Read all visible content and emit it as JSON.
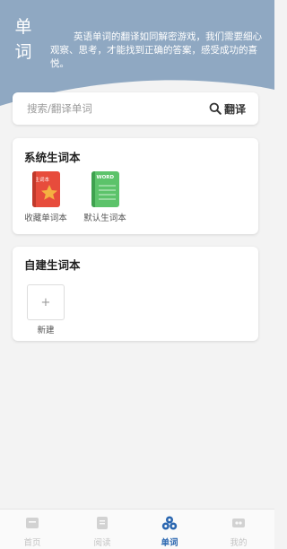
{
  "header": {
    "title": "单词",
    "quote": "英语单词的翻译如同解密游戏，我们需要细心观察、思考，才能找到正确的答案，感受成功的喜悦。"
  },
  "search": {
    "placeholder": "搜索/翻译单词",
    "button_label": "翻译"
  },
  "system_books": {
    "title": "系统生词本",
    "items": [
      {
        "label": "收藏单词本",
        "cover_text": "生词本",
        "color": "#e74c3c",
        "icon": "star-book-icon"
      },
      {
        "label": "默认生词本",
        "cover_text": "WORD",
        "color": "#5cc36a",
        "icon": "notebook-icon"
      }
    ]
  },
  "custom_books": {
    "title": "自建生词本",
    "new_symbol": "+",
    "new_label": "新建"
  },
  "tabbar": {
    "tabs": [
      {
        "label": "首页",
        "icon": "home-icon",
        "active": false
      },
      {
        "label": "阅读",
        "icon": "read-icon",
        "active": false
      },
      {
        "label": "单词",
        "icon": "word-icon",
        "active": true
      },
      {
        "label": "我的",
        "icon": "profile-icon",
        "active": false
      }
    ]
  },
  "colors": {
    "header_bg": "#8fa8c2",
    "accent": "#2a66b0"
  }
}
